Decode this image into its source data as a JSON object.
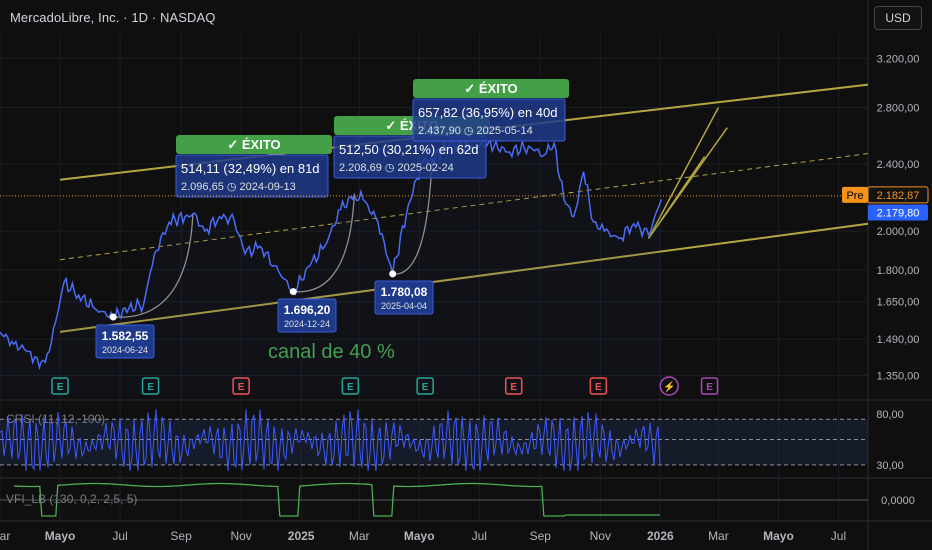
{
  "header": {
    "title": "MercadoLibre, Inc. · 1D · NASDAQ",
    "currency_button": "USD"
  },
  "colors": {
    "price": "#4a6cf7",
    "channel": "#b5a642",
    "success": "#4caf50",
    "grid": "#1c1e25",
    "label_bg": "#1e3a8a",
    "earnings_green": "#26a69a",
    "earnings_red": "#ef5350",
    "pre": "#f7931a",
    "vfi": "#4caf50",
    "crsi": "#3d5afe",
    "dividend": "#ab47bc"
  },
  "chart_data": [
    {
      "type": "line",
      "title": "MercadoLibre, Inc. · 1D · NASDAQ",
      "yscale": "log",
      "ylim": [
        1280,
        3420
      ],
      "xlim": [
        "2024-03-01",
        "2026-07-31"
      ],
      "y_ticks": [
        {
          "value": 3200,
          "label": "3.200,00"
        },
        {
          "value": 2800,
          "label": "2.800,00"
        },
        {
          "value": 2400,
          "label": "2.400,00"
        },
        {
          "value": 2000,
          "label": "2.000,00"
        },
        {
          "value": 1800,
          "label": "1.800,00"
        },
        {
          "value": 1650,
          "label": "1.650,00"
        },
        {
          "value": 1490,
          "label": "1.490,00"
        },
        {
          "value": 1350,
          "label": "1.350,00"
        }
      ],
      "x_ticks": [
        {
          "date": "2024-03-01",
          "label": "Mar"
        },
        {
          "date": "2024-05-01",
          "label": "Mayo"
        },
        {
          "date": "2024-07-01",
          "label": "Jul"
        },
        {
          "date": "2024-09-01",
          "label": "Sep"
        },
        {
          "date": "2024-11-01",
          "label": "Nov"
        },
        {
          "date": "2025-01-01",
          "label": "2025"
        },
        {
          "date": "2025-03-01",
          "label": "Mar"
        },
        {
          "date": "2025-05-01",
          "label": "Mayo"
        },
        {
          "date": "2025-07-01",
          "label": "Jul"
        },
        {
          "date": "2025-09-01",
          "label": "Sep"
        },
        {
          "date": "2025-11-01",
          "label": "Nov"
        },
        {
          "date": "2026-01-01",
          "label": "2026"
        },
        {
          "date": "2026-03-01",
          "label": "Mar"
        },
        {
          "date": "2026-05-01",
          "label": "Mayo"
        },
        {
          "date": "2026-07-01",
          "label": "Jul"
        }
      ],
      "series": [
        {
          "x": [
            "2024-03-01",
            "2024-03-15",
            "2024-04-01",
            "2024-04-10",
            "2024-04-20",
            "2024-05-05",
            "2024-05-20",
            "2024-06-05",
            "2024-06-24",
            "2024-07-10",
            "2024-07-25",
            "2024-08-05",
            "2024-08-20",
            "2024-09-05",
            "2024-09-13",
            "2024-09-25",
            "2024-10-10",
            "2024-10-25",
            "2024-11-05",
            "2024-11-20",
            "2024-12-05",
            "2024-12-24",
            "2025-01-10",
            "2025-01-25",
            "2025-02-10",
            "2025-02-24",
            "2025-03-05",
            "2025-03-20",
            "2025-04-04",
            "2025-04-20",
            "2025-05-05",
            "2025-05-14",
            "2025-06-01",
            "2025-06-20",
            "2025-07-10",
            "2025-08-01",
            "2025-08-20",
            "2025-09-05",
            "2025-09-15",
            "2025-09-25",
            "2025-10-05",
            "2025-10-15",
            "2025-10-25",
            "2025-11-05",
            "2025-11-20",
            "2025-12-05",
            "2025-12-20",
            "2026-01-02"
          ],
          "values": [
            1520,
            1470,
            1440,
            1380,
            1440,
            1740,
            1680,
            1620,
            1582,
            1620,
            1640,
            1880,
            2050,
            2080,
            2097,
            2000,
            2080,
            2060,
            1880,
            1920,
            1820,
            1696,
            1820,
            1920,
            2120,
            2209,
            2180,
            2050,
            1780,
            2150,
            2420,
            2438,
            2540,
            2500,
            2540,
            2480,
            2520,
            2460,
            2540,
            2180,
            2080,
            2350,
            2050,
            2000,
            1960,
            2040,
            1980,
            2180
          ]
        }
      ],
      "channel_lines": [
        {
          "name": "upper",
          "points": [
            [
              "2024-05-01",
              2300
            ],
            [
              "2026-07-31",
              2980
            ]
          ]
        },
        {
          "name": "middle",
          "points": [
            [
              "2024-05-01",
              1850
            ],
            [
              "2026-07-31",
              2470
            ]
          ]
        },
        {
          "name": "lower",
          "points": [
            [
              "2024-05-01",
              1520
            ],
            [
              "2026-07-31",
              2040
            ]
          ]
        }
      ],
      "annotations": [
        {
          "kind": "low",
          "date": "2024-06-24",
          "value": 1582.55,
          "label": "1.582,55",
          "sub": "2024-06-24"
        },
        {
          "kind": "low",
          "date": "2024-12-24",
          "value": 1696.2,
          "label": "1.696,20",
          "sub": "2024-12-24"
        },
        {
          "kind": "low",
          "date": "2025-04-04",
          "value": 1780.08,
          "label": "1.780,08",
          "sub": "2025-04-04"
        },
        {
          "kind": "gain",
          "badge": "✓ ÉXITO",
          "line1": "514,11 (32,49%) en 81d",
          "line2": "2.096,65 ◷ 2024-09-13"
        },
        {
          "kind": "gain",
          "badge": "✓ ÉXITO",
          "line1": "512,50 (30,21%) en 62d",
          "line2": "2.208,69 ◷ 2025-02-24"
        },
        {
          "kind": "gain",
          "badge": "✓ ÉXITO",
          "line1": "657,82 (36,95%) en 40d",
          "line2": "2.437,90 ◷ 2025-05-14"
        }
      ],
      "channel_label": "canal de 40 %",
      "pre_label": "Pre",
      "pre_price": "2.182,87",
      "last_price": "2.179,80",
      "events": [
        {
          "date": "2024-05-01",
          "kind": "E",
          "color": "green"
        },
        {
          "date": "2024-08-01",
          "kind": "E",
          "color": "green"
        },
        {
          "date": "2024-11-01",
          "kind": "E",
          "color": "red"
        },
        {
          "date": "2025-02-20",
          "kind": "E",
          "color": "green"
        },
        {
          "date": "2025-05-07",
          "kind": "E",
          "color": "green"
        },
        {
          "date": "2025-08-05",
          "kind": "E",
          "color": "red"
        },
        {
          "date": "2025-10-30",
          "kind": "E",
          "color": "red"
        },
        {
          "date": "2026-01-10",
          "kind": "⚡",
          "color": "purple"
        },
        {
          "date": "2026-02-20",
          "kind": "E",
          "color": "purple"
        }
      ]
    },
    {
      "type": "line",
      "title": "CRSI (11, 12, 100)",
      "ylim": [
        20,
        90
      ],
      "y_ticks": [
        {
          "value": 80,
          "label": "80,00"
        },
        {
          "value": 30,
          "label": "30,00"
        }
      ],
      "bands": [
        75,
        55,
        30
      ]
    },
    {
      "type": "line",
      "title": "VFI_LB (130, 0,2, 2,5, 5)",
      "y_ticks": [
        {
          "value": 0,
          "label": "0,0000"
        }
      ]
    }
  ]
}
